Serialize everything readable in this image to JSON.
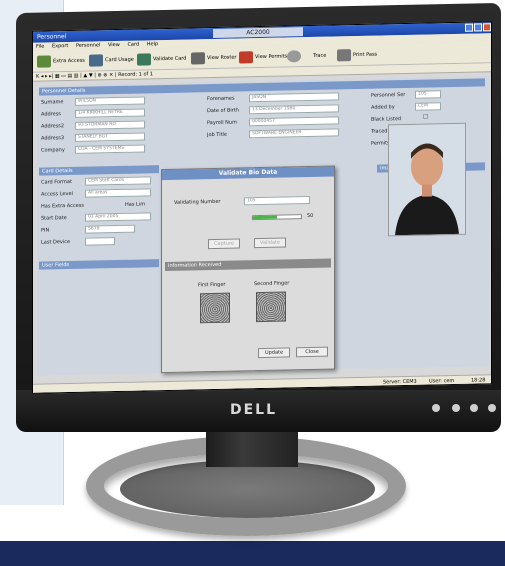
{
  "app": {
    "window_title": "Personnel",
    "center_title": "AC2000",
    "menu": [
      "File",
      "Export",
      "Personnel",
      "View",
      "Card",
      "Help"
    ],
    "toolbar": [
      {
        "label": "Extra Access",
        "icon": "group-icon"
      },
      {
        "label": "Card Usage",
        "icon": "person-card-icon"
      },
      {
        "label": "Validate Card",
        "icon": "validate-card-icon"
      },
      {
        "label": "View Roster",
        "icon": "roster-icon"
      },
      {
        "label": "View Permits",
        "icon": "permits-icon"
      },
      {
        "label": "",
        "icon": "search-person-icon"
      },
      {
        "label": "Trace",
        "icon": "trace-icon"
      },
      {
        "label": "Print Pass",
        "icon": "printer-icon"
      }
    ],
    "navbar": "K ◂ ▸ ▸| ▦ ▭ ▤ ▥ | ▲ ▼ | ⊕ ⊗ ✕ | Record: 1 of 1"
  },
  "personnel": {
    "header": "Personnel Details",
    "fields_left": [
      {
        "label": "Surname",
        "value": "WILSON"
      },
      {
        "label": "Address",
        "value": "1/4 KIRKHILL RETRE"
      },
      {
        "label": "Address2",
        "value": "93 STORMAN RD"
      },
      {
        "label": "Address3",
        "value": "STANELY BGT"
      },
      {
        "label": "Company",
        "value": "CDA - CEM SYSTEMS"
      }
    ],
    "fields_mid": [
      {
        "label": "Forenames",
        "value": "JASON"
      },
      {
        "label": "Date of Birth",
        "value": "13 December 1980"
      },
      {
        "label": "Payroll Num",
        "value": "00000457"
      },
      {
        "label": "Job Title",
        "value": "SOFTWARE ENGINEER"
      }
    ],
    "fields_right": [
      {
        "label": "Personnel Ser",
        "value": "105"
      },
      {
        "label": "Added by",
        "value": "CEM"
      },
      {
        "label": "Black Listed",
        "value": ""
      },
      {
        "label": "Traced",
        "value": ""
      },
      {
        "label": "Permits",
        "value": ""
      }
    ]
  },
  "card": {
    "header": "Card Details",
    "rows": [
      {
        "label": "Card Format",
        "value": "CEM Staff Cards"
      },
      {
        "label": "Access Level",
        "value": "All areas"
      },
      {
        "label": "Has Extra Access",
        "value": "Has Lim"
      },
      {
        "label": "Start Date",
        "value": "01 April 2005"
      },
      {
        "label": "PIN",
        "value": "5678"
      },
      {
        "label": "Last Device",
        "value": ""
      }
    ]
  },
  "user_fields": {
    "header": "User Fields"
  },
  "image_panel": {
    "header": "Images"
  },
  "dialog": {
    "title": "Validate Bio Data",
    "issue_label": "Validating Number",
    "issue_value": "105",
    "progress_value": "50",
    "capture_button": "Capture",
    "validate_button": "Validate",
    "info_header": "Information Received",
    "first_finger": "First Finger",
    "second_finger": "Second Finger",
    "update_button": "Update",
    "close_button": "Close"
  },
  "status": {
    "server": "Server: CEM3",
    "user": "User: cem",
    "time": "18:28"
  },
  "monitor": {
    "brand": "DELL"
  },
  "colors": {
    "accent": "#1d46a8",
    "panel_header": "#7a98c8",
    "band": "#1a2a5c"
  }
}
